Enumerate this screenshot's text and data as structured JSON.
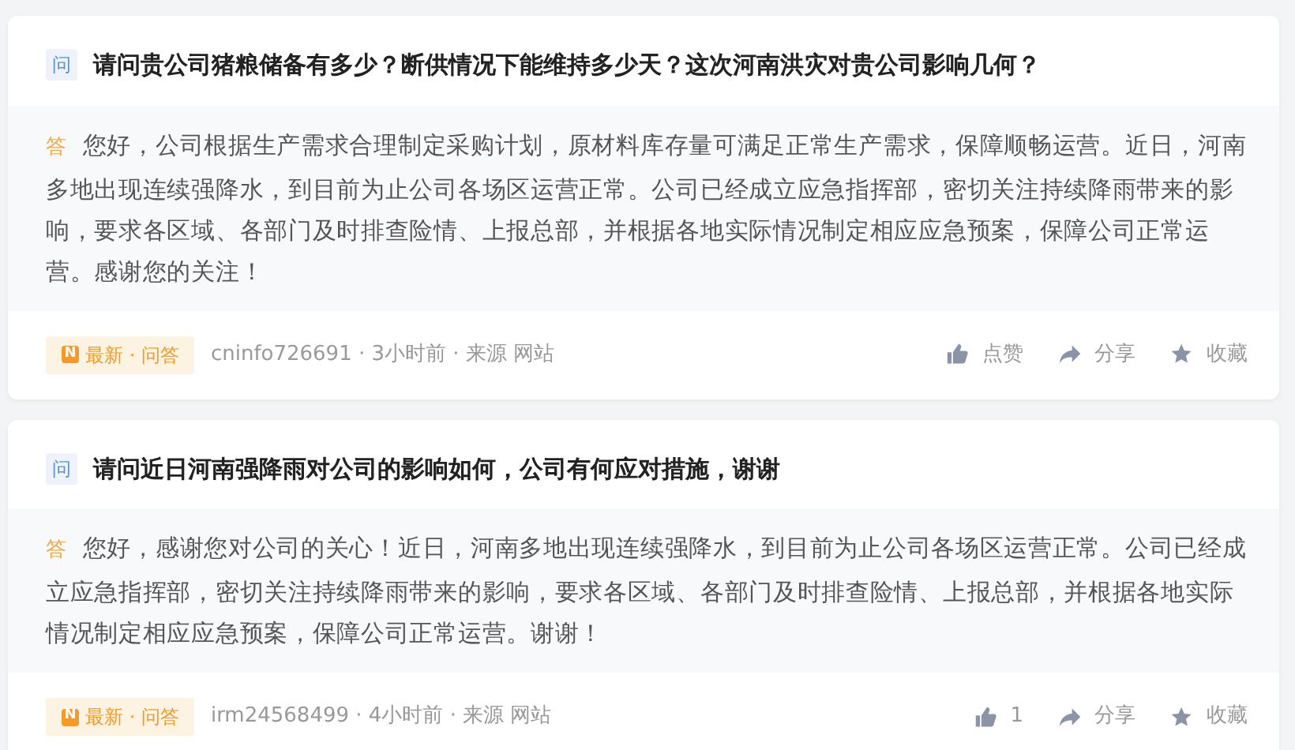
{
  "posts": [
    {
      "question_badge": "问",
      "question": "请问贵公司猪粮储备有多少？断供情况下能维持多少天？这次河南洪灾对贵公司影响几何？",
      "answer_badge": "答",
      "answer": "您好，公司根据生产需求合理制定采购计划，原材料库存量可满足正常生产需求，保障顺畅运营。近日，河南多地出现连续强降水，到目前为止公司各场区运营正常。公司已经成立应急指挥部，密切关注持续降雨带来的影响，要求各区域、各部门及时排查险情、上报总部，并根据各地实际情况制定相应应急预案，保障公司正常运营。感谢您的关注！",
      "tag_icon": "N",
      "tag": "最新 · 问答",
      "meta": "cninfo726691 · 3小时前 · 来源 网站",
      "actions": [
        {
          "kind": "like",
          "label": "点赞"
        },
        {
          "kind": "share",
          "label": "分享"
        },
        {
          "kind": "favorite",
          "label": "收藏"
        }
      ]
    },
    {
      "question_badge": "问",
      "question": "请问近日河南强降雨对公司的影响如何，公司有何应对措施，谢谢",
      "answer_badge": "答",
      "answer": "您好，感谢您对公司的关心！近日，河南多地出现连续强降水，到目前为止公司各场区运营正常。公司已经成立应急指挥部，密切关注持续降雨带来的影响，要求各区域、各部门及时排查险情、上报总部，并根据各地实际情况制定相应应急预案，保障公司正常运营。谢谢！",
      "tag_icon": "N",
      "tag": "最新 · 问答",
      "meta": "irm24568499 · 4小时前 · 来源 网站",
      "actions": [
        {
          "kind": "like",
          "label": "1"
        },
        {
          "kind": "share",
          "label": "分享"
        },
        {
          "kind": "favorite",
          "label": "收藏"
        }
      ]
    }
  ]
}
